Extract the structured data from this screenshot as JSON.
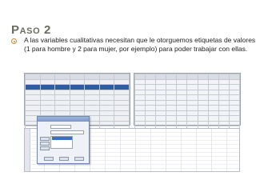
{
  "slide": {
    "title": "Paso 2",
    "bullet_text": "A las variables cualitativas necesitan que le otorguemos etiquetas de valores (1 para hombre y 2 para mujer, por ejemplo) para poder trabajar con ellas."
  },
  "colors": {
    "title": "#6b6b5f",
    "bullet": "#c98a3b",
    "selection": "#2e5da8"
  }
}
